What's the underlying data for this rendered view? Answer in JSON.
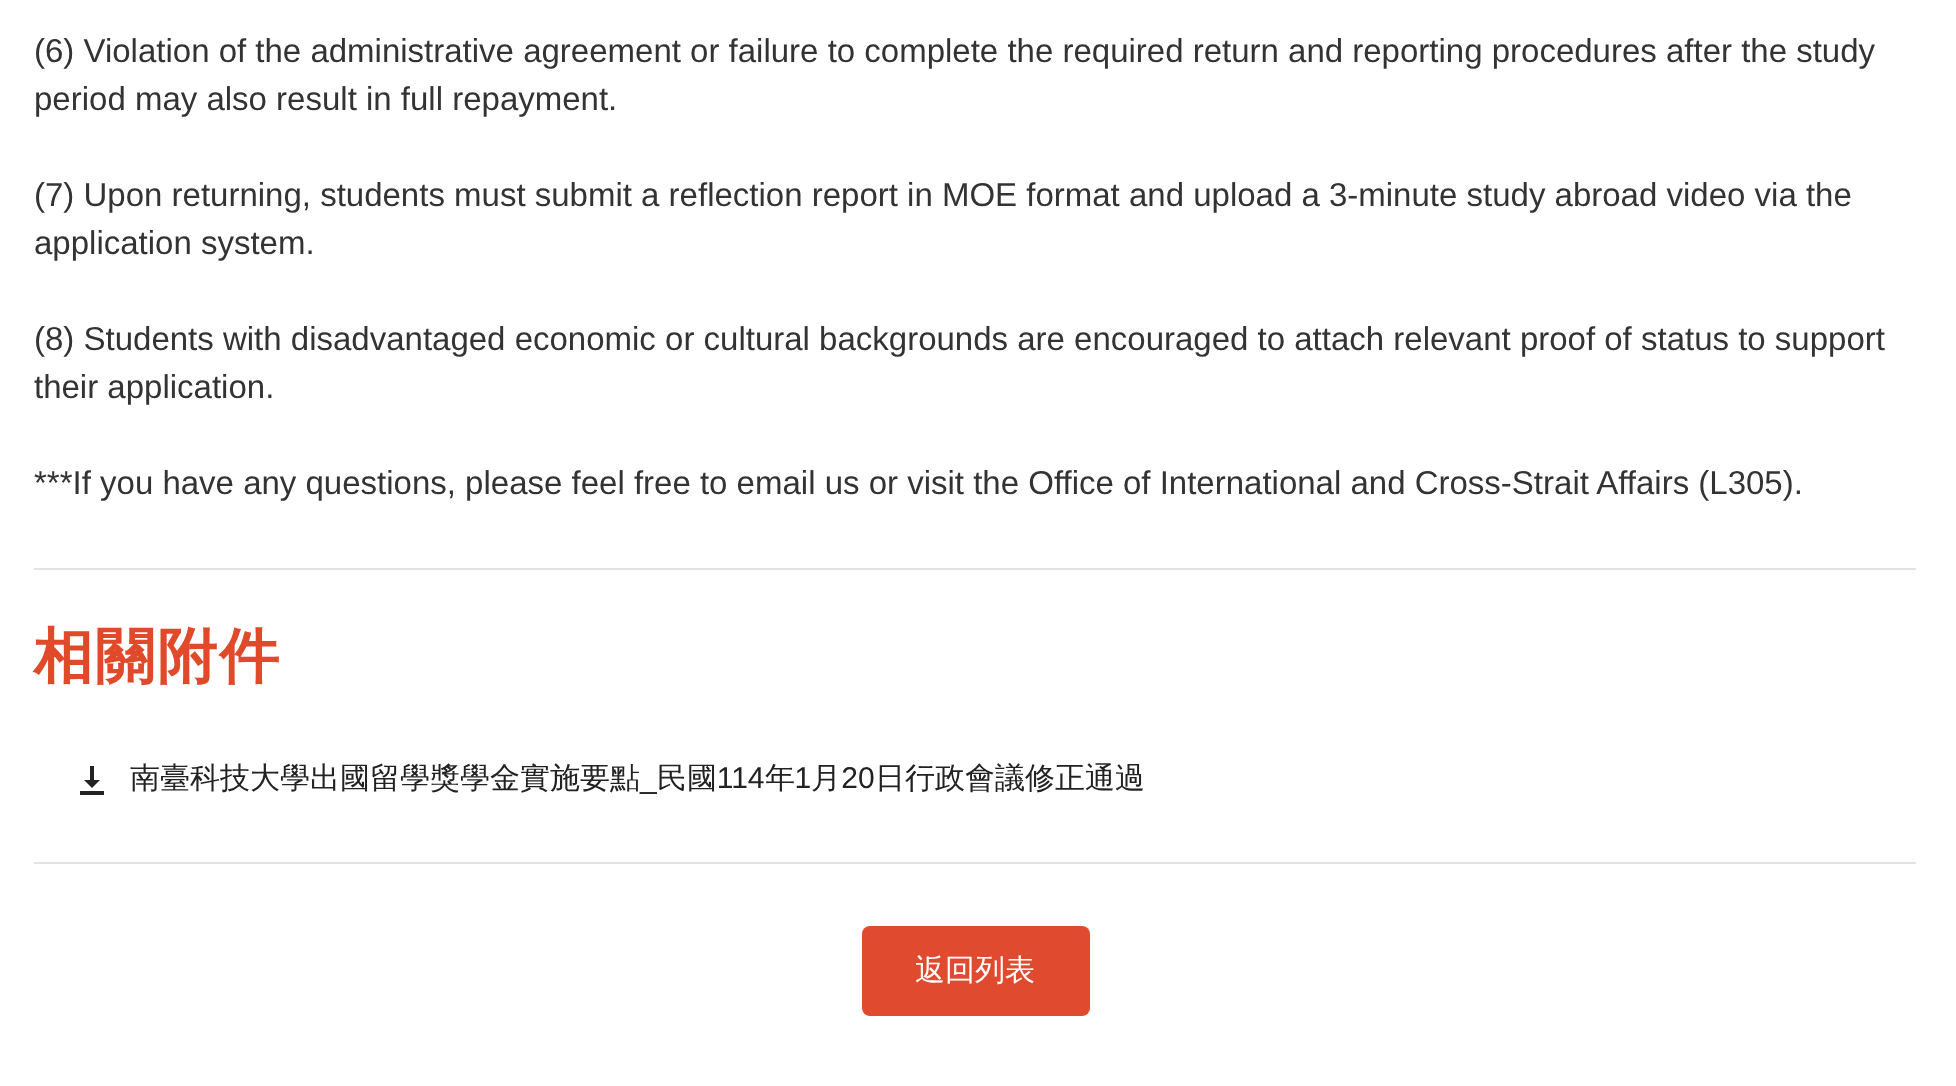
{
  "paragraphs": [
    "(6) Violation of the administrative agreement or failure to complete the required return and reporting procedures after the study period may also result in full repayment.",
    "(7) Upon returning, students must submit a reflection report in MOE format and upload a 3-minute study abroad video via the application system.",
    "(8) Students with disadvantaged economic or cultural backgrounds are encouraged to attach relevant proof of status to support their application.",
    "***If you have any questions, please feel free to email us or visit the Office of International and Cross-Strait Affairs (L305)."
  ],
  "attachments": {
    "title": "相關附件",
    "files": [
      {
        "name": "南臺科技大學出國留學獎學金實施要點_民國114年1月20日行政會議修正通過"
      }
    ]
  },
  "back_button": "返回列表"
}
